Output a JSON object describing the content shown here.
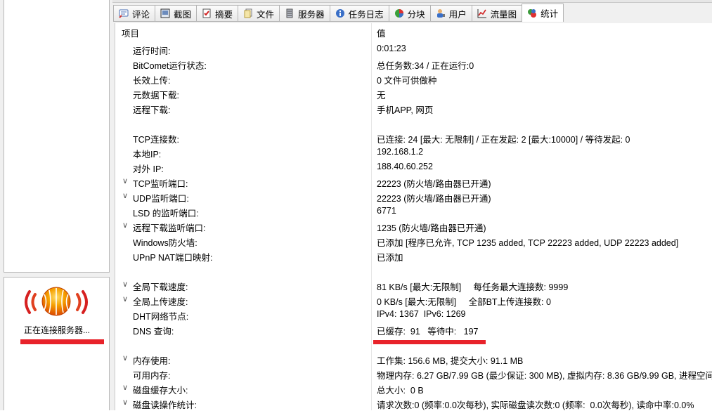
{
  "left": {
    "status_text": "正在连接服务器..."
  },
  "tabs": [
    {
      "label": "评论",
      "icon": "comment-icon"
    },
    {
      "label": "截图",
      "icon": "screenshot-icon"
    },
    {
      "label": "摘要",
      "icon": "summary-icon"
    },
    {
      "label": "文件",
      "icon": "files-icon"
    },
    {
      "label": "服务器",
      "icon": "server-icon"
    },
    {
      "label": "任务日志",
      "icon": "info-icon"
    },
    {
      "label": "分块",
      "icon": "pie-chart-icon"
    },
    {
      "label": "用户",
      "icon": "user-icon"
    },
    {
      "label": "流量图",
      "icon": "line-chart-icon"
    },
    {
      "label": "统计",
      "icon": "stats-icon",
      "active": true
    }
  ],
  "table": {
    "col_item": "项目",
    "col_value": "值",
    "rows": [
      {
        "key": "运行时间:",
        "value": "0:01:23",
        "expandable": false
      },
      {
        "key": "BitComet运行状态:",
        "value": "总任务数:34 / 正在运行:0",
        "expandable": false
      },
      {
        "key": "长效上传:",
        "value": "0 文件可供做种",
        "expandable": false
      },
      {
        "key": "元数据下载:",
        "value": "无",
        "expandable": false
      },
      {
        "key": "远程下载:",
        "value": "手机APP, 网页",
        "expandable": false
      },
      {
        "key": "",
        "value": "",
        "expandable": false
      },
      {
        "key": "TCP连接数:",
        "value": "已连接: 24 [最大: 无限制] / 正在发起: 2 [最大:10000] / 等待发起: 0",
        "expandable": false
      },
      {
        "key": "本地IP:",
        "value": "192.168.1.2",
        "expandable": false
      },
      {
        "key": "对外 IP:",
        "value": "188.40.60.252",
        "expandable": false
      },
      {
        "key": "TCP监听端口:",
        "value": "22223 (防火墙/路由器已开通)",
        "expandable": true
      },
      {
        "key": "UDP监听端口:",
        "value": "22223 (防火墙/路由器已开通)",
        "expandable": true
      },
      {
        "key": "LSD 的监听端口:",
        "value": "6771",
        "expandable": false
      },
      {
        "key": "远程下载监听端口:",
        "value": "1235 (防火墙/路由器已开通)",
        "expandable": true
      },
      {
        "key": "Windows防火墙:",
        "value": "已添加 [程序已允许, TCP 1235 added, TCP 22223 added, UDP 22223 added]",
        "expandable": false
      },
      {
        "key": "UPnP NAT端口映射:",
        "value": "已添加",
        "expandable": false
      },
      {
        "key": "",
        "value": "",
        "expandable": false
      },
      {
        "key": "全局下载速度:",
        "value": "81 KB/s [最大:无限制]     每任务最大连接数: 9999",
        "expandable": true
      },
      {
        "key": "全局上传速度:",
        "value": "0 KB/s [最大:无限制]     全部BT上传连接数: 0",
        "expandable": true
      },
      {
        "key": "DHT网络节点:",
        "value": "IPv4: 1367  IPv6: 1269",
        "expandable": false
      },
      {
        "key": "DNS 查询:",
        "value": "已缓存:  91   等待中:   197",
        "expandable": false
      },
      {
        "key": "",
        "value": "",
        "expandable": false
      },
      {
        "key": "内存使用:",
        "value": "工作集: 156.6 MB, 提交大小: 91.1 MB",
        "expandable": true
      },
      {
        "key": "可用内存:",
        "value": "物理内存: 6.27 GB/7.99 GB (最少保证: 300 MB), 虚拟内存: 8.36 GB/9.99 GB, 进程空间:",
        "expandable": false
      },
      {
        "key": "磁盘缓存大小:",
        "value": "总大小:  0 B",
        "expandable": true
      },
      {
        "key": "磁盘读操作统计:",
        "value": "请求次数:0 (频率:0.0次每秒), 实际磁盘读次数:0 (频率:  0.0次每秒), 读命中率:0.0%",
        "expandable": true
      }
    ]
  },
  "colors": {
    "highlight_red": "#e8222a",
    "logo_orange": "#f08a00",
    "logo_red": "#d62020"
  }
}
